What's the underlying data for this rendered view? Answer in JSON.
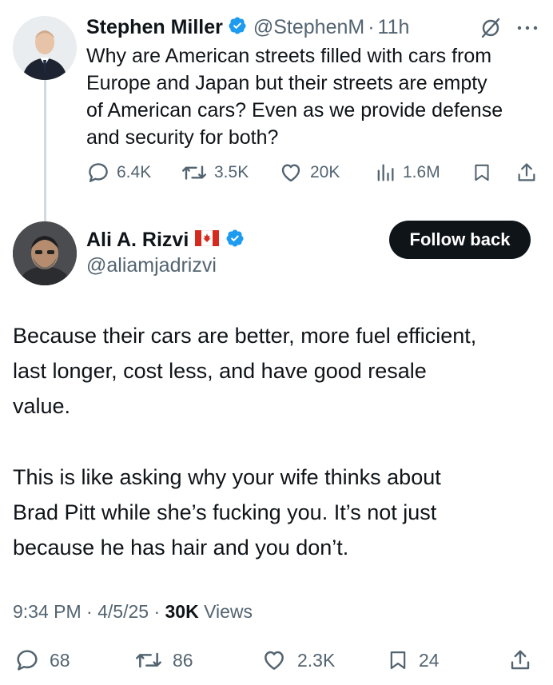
{
  "colors": {
    "text": "#0f1419",
    "muted": "#536471",
    "verified": "#1d9bf0",
    "line": "#cfd9de",
    "button": "#0f1419"
  },
  "original_post": {
    "author_name": "Stephen Miller",
    "handle": "@StephenM",
    "separator": "·",
    "time": "11h",
    "text_lines": [
      "Why are American streets filled with cars from",
      "Europe and Japan but their streets are empty",
      "of American cars? Even as we provide defense",
      "and security for both?"
    ],
    "actions": {
      "replies": "6.4K",
      "reposts": "3.5K",
      "likes": "20K",
      "views": "1.6M"
    },
    "icons": [
      "grok-icon",
      "more-icon",
      "reply-icon",
      "repost-icon",
      "like-icon",
      "views-icon",
      "bookmark-icon",
      "share-icon",
      "verified-icon"
    ]
  },
  "reply": {
    "author_name": "Ali A. Rizvi",
    "flag": "🇨🇦",
    "handle": "@aliamjadrizvi",
    "follow_label": "Follow back",
    "paragraph1": [
      "Because their cars are better, more fuel efficient,",
      "last longer, cost less, and have good resale",
      "value."
    ],
    "paragraph2": [
      "This is like asking why your wife thinks about",
      "Brad Pitt while she’s fucking you. It’s not just",
      "because he has hair and you don’t."
    ],
    "time": "9:34 PM",
    "sep1": "·",
    "date": "4/5/25",
    "sep2": "·",
    "views_count": "30K",
    "views_label": "Views",
    "actions": {
      "replies": "68",
      "reposts": "86",
      "likes": "2.3K",
      "bookmarks": "24"
    }
  }
}
